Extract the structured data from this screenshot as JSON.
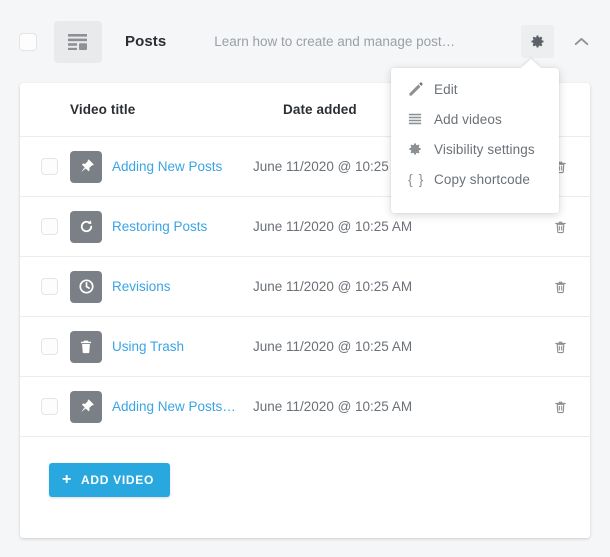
{
  "header": {
    "select_all_checkbox": "unchecked",
    "playlist_icon": "posts-list-icon",
    "title": "Posts",
    "description": "Learn how to create and manage post…",
    "gear_icon": "gear-icon",
    "collapse_icon": "chevron-up-icon"
  },
  "dropdown": {
    "visible": true,
    "items": [
      {
        "label": "Edit",
        "icon": "pencil-icon"
      },
      {
        "label": "Add videos",
        "icon": "list-icon"
      },
      {
        "label": "Visibility settings",
        "icon": "gear-icon"
      },
      {
        "label": "Copy shortcode",
        "icon": "braces-icon"
      }
    ]
  },
  "table": {
    "columns": {
      "title": "Video title",
      "date": "Date added"
    },
    "rows": [
      {
        "title": "Adding New Posts",
        "date": "June 11/2020 @ 10:25 AM",
        "icon": "pin-icon",
        "delete_icon": "trash-icon",
        "checkbox": "unchecked"
      },
      {
        "title": "Restoring Posts",
        "date": "June 11/2020 @ 10:25 AM",
        "icon": "restore-icon",
        "delete_icon": "trash-icon",
        "checkbox": "unchecked"
      },
      {
        "title": "Revisions",
        "date": "June 11/2020 @ 10:25 AM",
        "icon": "history-clock-icon",
        "delete_icon": "trash-icon",
        "checkbox": "unchecked"
      },
      {
        "title": "Using Trash",
        "date": "June 11/2020 @ 10:25 AM",
        "icon": "trash-icon",
        "delete_icon": "trash-icon",
        "checkbox": "unchecked"
      },
      {
        "title": "Adding New Posts…",
        "date": "June 11/2020 @ 10:25 AM",
        "icon": "pin-icon",
        "delete_icon": "trash-icon",
        "checkbox": "unchecked"
      }
    ]
  },
  "footer": {
    "add_video_label": "ADD VIDEO",
    "add_video_plus": "+"
  },
  "colors": {
    "accent": "#29a8e0",
    "link": "#3aa4e4",
    "icon_tile": "#7b8086",
    "page_bg": "#f5f6f7",
    "card_bg": "#ffffff",
    "border": "#ececec",
    "muted_text": "#6b7177",
    "placeholder_text": "#9aa0a6"
  }
}
